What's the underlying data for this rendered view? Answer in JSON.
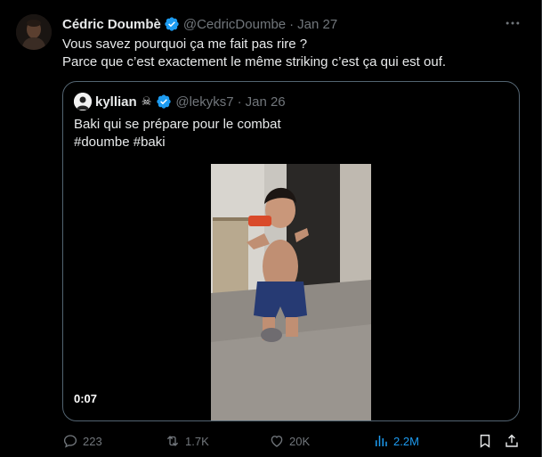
{
  "tweet": {
    "author_name": "Cédric Doumbè",
    "handle": "@CedricDoumbe",
    "separator": "·",
    "date": "Jan 27",
    "text_lines": [
      "Vous savez pourquoi ça me fait pas rire ?",
      "Parce que c’est exactement le même striking c’est ça qui est ouf."
    ]
  },
  "quote": {
    "author_name": "kyllian",
    "emoji": "☠",
    "handle": "@lekyks7",
    "separator": "·",
    "date": "Jan 26",
    "text_line": "Baki qui se prépare pour le combat",
    "hashtags": [
      "#doumbe",
      "#baki"
    ],
    "video_duration": "0:07"
  },
  "actions": {
    "replies": "223",
    "reposts": "1.7K",
    "likes": "20K",
    "views": "2.2M"
  },
  "colors": {
    "background": "#000000",
    "text": "#e7e9ea",
    "muted": "#71767b",
    "accent": "#1d9bf0",
    "border": "#536471"
  },
  "icons": {
    "verified": "verified-badge-icon",
    "more": "more-horizontal-icon",
    "reply": "reply-icon",
    "repost": "repost-icon",
    "like": "heart-icon",
    "views": "views-chart-icon",
    "bookmark": "bookmark-icon",
    "share": "share-icon"
  }
}
